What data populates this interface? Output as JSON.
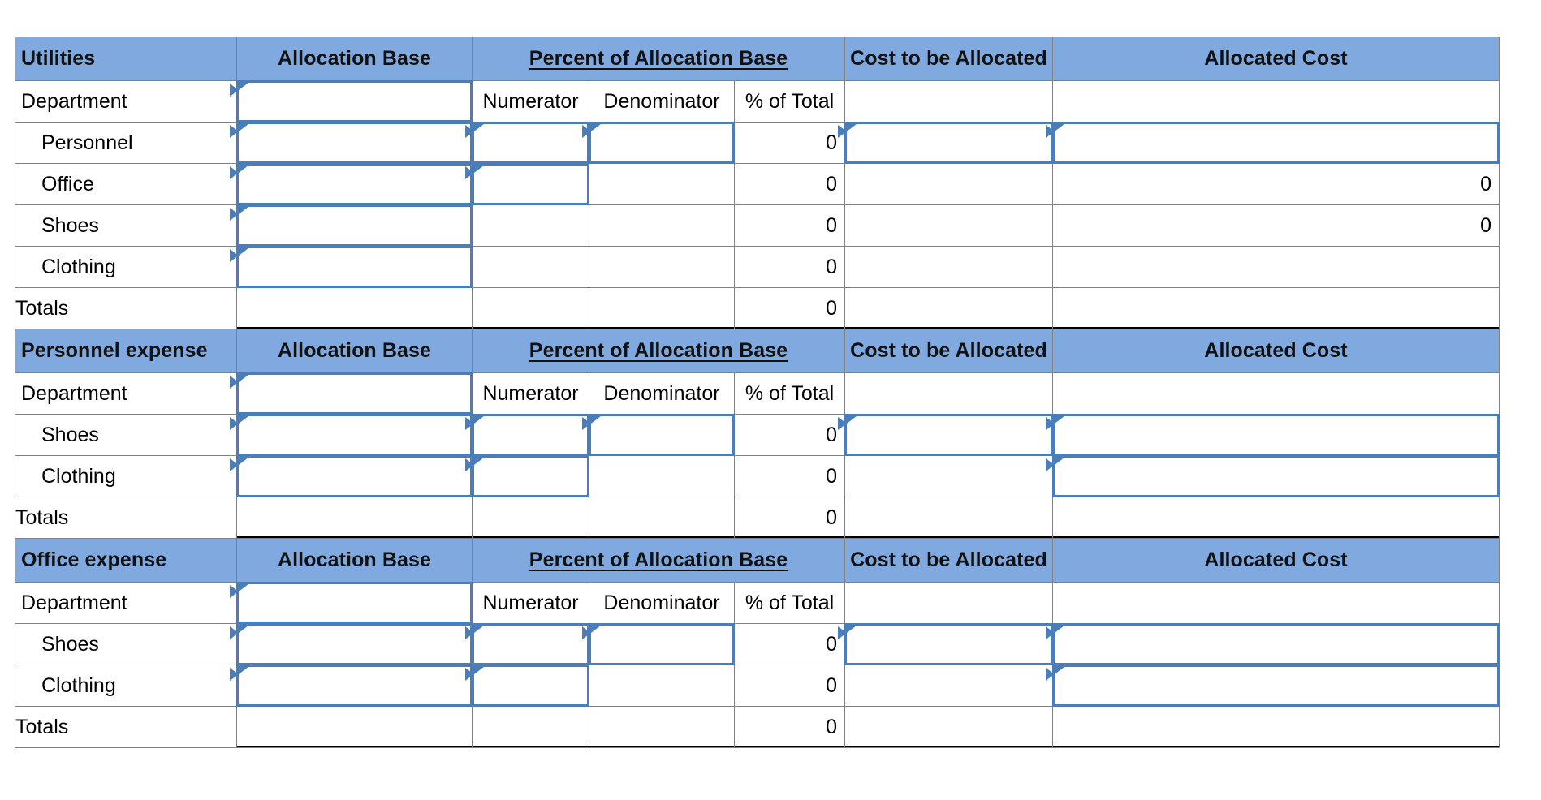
{
  "columns": {
    "label": "",
    "allocation_base": "Allocation Base",
    "percent_group": "Percent of Allocation Base",
    "numerator": "Numerator",
    "denominator": "Denominator",
    "pct_of_total": "% of Total",
    "cost_to_be_allocated": "Cost to be Allocated",
    "allocated_cost": "Allocated Cost"
  },
  "labels": {
    "department": "Department",
    "totals": "Totals"
  },
  "colors": {
    "header_blue": "#80AADF",
    "answer_yellow": "#FDFDAA",
    "selection_blue": "#4A7EBB",
    "gridline": "#808080",
    "rule_black": "#000000"
  },
  "sections": [
    {
      "title": "Utilities",
      "rows": [
        {
          "label": "Department",
          "indent": false,
          "allocation_base": "",
          "allocation_base_input": true,
          "numerator": "",
          "numerator_input": false,
          "denominator": "",
          "denominator_input": false,
          "pct_of_total": "",
          "cost_to_be_allocated": "",
          "cost_input": false,
          "allocated_cost": "",
          "allocated_yellow": false,
          "allocated_input": false
        },
        {
          "label": "Personnel",
          "indent": true,
          "allocation_base": "",
          "allocation_base_input": true,
          "numerator": "",
          "numerator_input": true,
          "denominator": "",
          "denominator_input": true,
          "pct_of_total": "0",
          "cost_to_be_allocated": "",
          "cost_input": true,
          "allocated_cost": "",
          "allocated_yellow": true,
          "allocated_input": true
        },
        {
          "label": "Office",
          "indent": true,
          "allocation_base": "",
          "allocation_base_input": true,
          "numerator": "",
          "numerator_input": true,
          "denominator": "",
          "denominator_input": false,
          "pct_of_total": "0",
          "cost_to_be_allocated": "",
          "cost_input": false,
          "allocated_cost": "0",
          "allocated_yellow": true,
          "allocated_input": false
        },
        {
          "label": "Shoes",
          "indent": true,
          "allocation_base": "",
          "allocation_base_input": true,
          "numerator": "",
          "numerator_input": false,
          "denominator": "",
          "denominator_input": false,
          "pct_of_total": "0",
          "cost_to_be_allocated": "",
          "cost_input": false,
          "allocated_cost": "0",
          "allocated_yellow": true,
          "allocated_input": false
        },
        {
          "label": "Clothing",
          "indent": true,
          "allocation_base": "",
          "allocation_base_input": true,
          "numerator": "",
          "numerator_input": false,
          "denominator": "",
          "denominator_input": false,
          "pct_of_total": "0",
          "cost_to_be_allocated": "",
          "cost_input": false,
          "allocated_cost": "",
          "allocated_yellow": true,
          "allocated_input": false
        },
        {
          "label": "Totals",
          "indent": false,
          "is_total": true,
          "allocation_base": "",
          "allocation_base_input": false,
          "numerator": "",
          "numerator_input": false,
          "denominator": "",
          "denominator_input": false,
          "pct_of_total": "0",
          "cost_to_be_allocated": "",
          "cost_input": false,
          "allocated_cost": "",
          "allocated_yellow": false,
          "allocated_input": false
        }
      ]
    },
    {
      "title": "Personnel expense",
      "rows": [
        {
          "label": "Department",
          "indent": false,
          "allocation_base": "",
          "allocation_base_input": true,
          "numerator": "",
          "numerator_input": false,
          "denominator": "",
          "denominator_input": false,
          "pct_of_total": "",
          "cost_to_be_allocated": "",
          "cost_input": false,
          "allocated_cost": "",
          "allocated_yellow": false,
          "allocated_input": false
        },
        {
          "label": "Shoes",
          "indent": true,
          "allocation_base": "",
          "allocation_base_input": true,
          "numerator": "",
          "numerator_input": true,
          "denominator": "",
          "denominator_input": true,
          "pct_of_total": "0",
          "cost_to_be_allocated": "",
          "cost_input": true,
          "allocated_cost": "",
          "allocated_yellow": true,
          "allocated_input": true
        },
        {
          "label": "Clothing",
          "indent": true,
          "allocation_base": "",
          "allocation_base_input": true,
          "numerator": "",
          "numerator_input": true,
          "denominator": "",
          "denominator_input": false,
          "pct_of_total": "0",
          "cost_to_be_allocated": "",
          "cost_input": false,
          "allocated_cost": "",
          "allocated_yellow": true,
          "allocated_input": true
        },
        {
          "label": "Totals",
          "indent": false,
          "is_total": true,
          "allocation_base": "",
          "allocation_base_input": false,
          "numerator": "",
          "numerator_input": false,
          "denominator": "",
          "denominator_input": false,
          "pct_of_total": "0",
          "cost_to_be_allocated": "",
          "cost_input": false,
          "allocated_cost": "",
          "allocated_yellow": false,
          "allocated_input": false
        }
      ]
    },
    {
      "title": "Office expense",
      "rows": [
        {
          "label": "Department",
          "indent": false,
          "allocation_base": "",
          "allocation_base_input": true,
          "numerator": "",
          "numerator_input": false,
          "denominator": "",
          "denominator_input": false,
          "pct_of_total": "",
          "cost_to_be_allocated": "",
          "cost_input": false,
          "allocated_cost": "",
          "allocated_yellow": false,
          "allocated_input": false
        },
        {
          "label": "Shoes",
          "indent": true,
          "allocation_base": "",
          "allocation_base_input": true,
          "numerator": "",
          "numerator_input": true,
          "denominator": "",
          "denominator_input": true,
          "pct_of_total": "0",
          "cost_to_be_allocated": "",
          "cost_input": true,
          "allocated_cost": "",
          "allocated_yellow": true,
          "allocated_input": true
        },
        {
          "label": "Clothing",
          "indent": true,
          "allocation_base": "",
          "allocation_base_input": true,
          "numerator": "",
          "numerator_input": true,
          "denominator": "",
          "denominator_input": false,
          "pct_of_total": "0",
          "cost_to_be_allocated": "",
          "cost_input": false,
          "allocated_cost": "",
          "allocated_yellow": true,
          "allocated_input": true
        },
        {
          "label": "Totals",
          "indent": false,
          "is_total": true,
          "allocation_base": "",
          "allocation_base_input": false,
          "numerator": "",
          "numerator_input": false,
          "denominator": "",
          "denominator_input": false,
          "pct_of_total": "0",
          "cost_to_be_allocated": "",
          "cost_input": false,
          "allocated_cost": "",
          "allocated_yellow": false,
          "allocated_input": false
        }
      ]
    }
  ]
}
